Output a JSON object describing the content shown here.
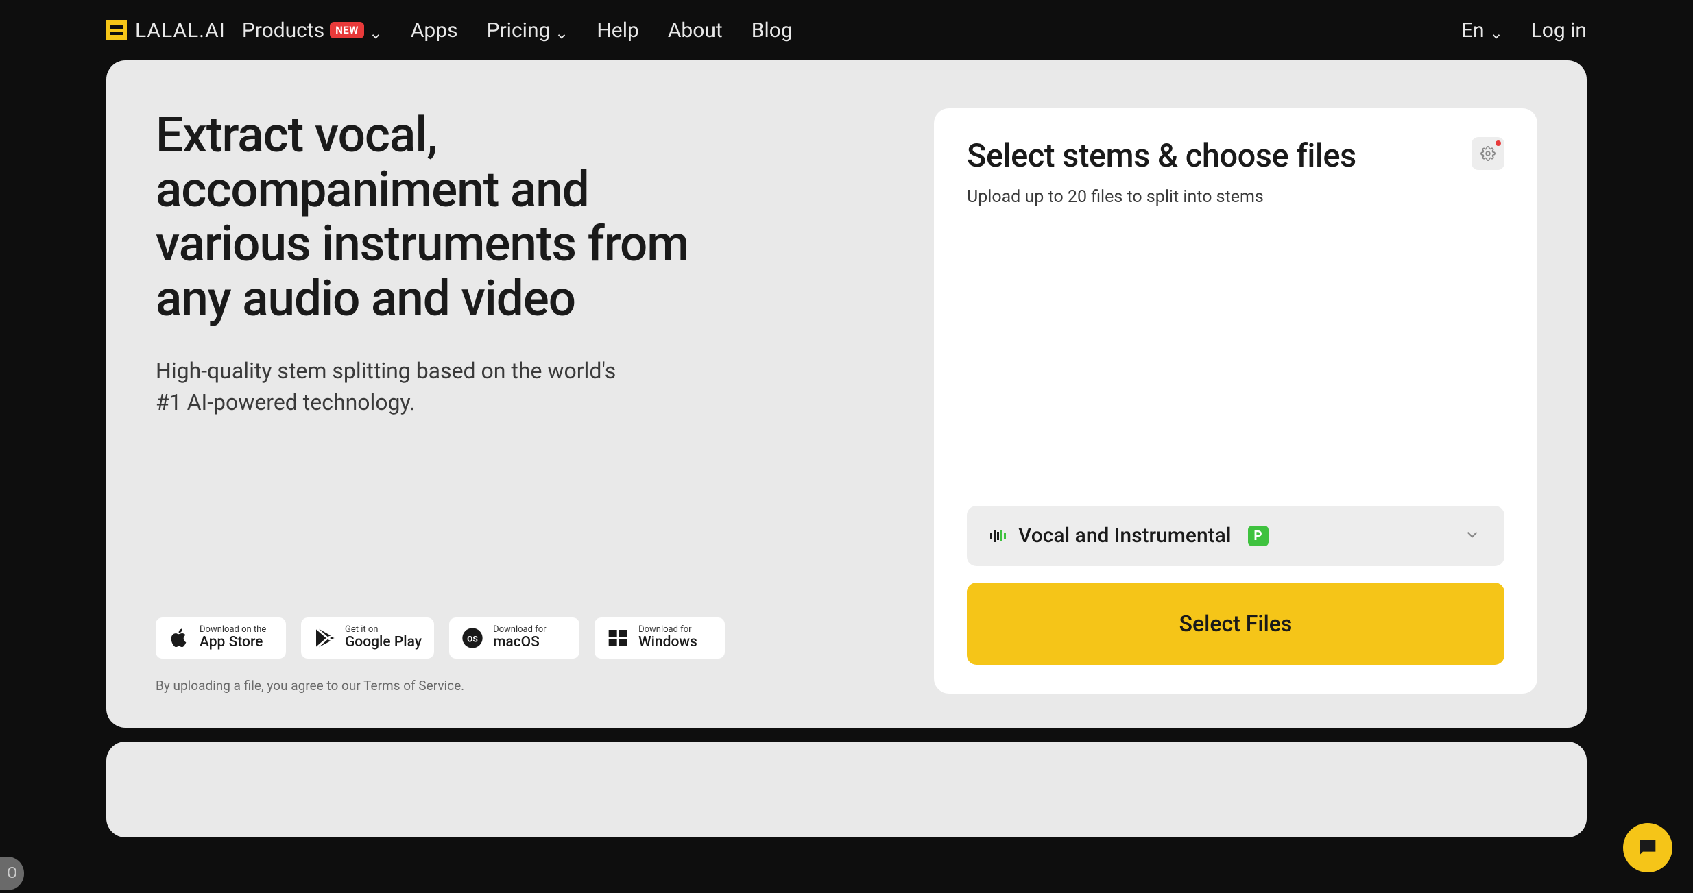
{
  "brand": {
    "name": "LALAL.AI"
  },
  "nav": {
    "products": "Products",
    "products_badge": "NEW",
    "apps": "Apps",
    "pricing": "Pricing",
    "help": "Help",
    "about": "About",
    "blog": "Blog"
  },
  "header_right": {
    "lang": "En",
    "login": "Log in"
  },
  "hero": {
    "title": "Extract vocal, accompaniment and various instruments from any audio and video",
    "subtitle": "High-quality stem splitting based on the world's #1 AI-powered technology."
  },
  "downloads": {
    "appstore": {
      "small": "Download on the",
      "big": "App Store"
    },
    "gplay": {
      "small": "Get it on",
      "big": "Google Play"
    },
    "macos": {
      "small": "Download for",
      "big": "macOS"
    },
    "windows": {
      "small": "Download for",
      "big": "Windows"
    }
  },
  "terms": {
    "prefix": "By uploading a file, you agree to our ",
    "link": "Terms of Service",
    "suffix": "."
  },
  "panel": {
    "title": "Select stems & choose files",
    "subtitle": "Upload up to 20 files to split into stems",
    "stem_selected": "Vocal and Instrumental",
    "select_button": "Select Files"
  },
  "colors": {
    "accent": "#f5c518",
    "danger": "#e83a3a",
    "green": "#3fc23f",
    "bg_dark": "#0e0e0e",
    "card": "#e9e9e9"
  }
}
